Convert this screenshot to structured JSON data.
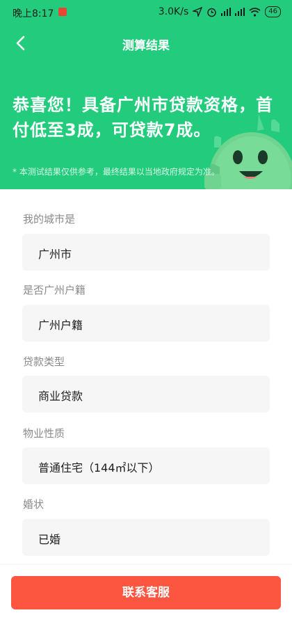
{
  "status_bar": {
    "time": "晚上8:17",
    "network_speed": "3.0K/s",
    "battery": "46",
    "icons": [
      "app-notification-icon",
      "location-icon",
      "alarm-icon",
      "hd-signal-icon",
      "hd-signal-icon",
      "wifi-icon",
      "battery-icon"
    ]
  },
  "header": {
    "title": "测算结果",
    "back_icon": "chevron-left-icon"
  },
  "result": {
    "headline": "恭喜您！具备广州市贷款资格，首付低至3成，可贷款7成。",
    "disclaimer": "* 本测试结果仅供参考，最终结果以当地政府规定为准。"
  },
  "fields": [
    {
      "label": "我的城市是",
      "value": "广州市"
    },
    {
      "label": "是否广州户籍",
      "value": "广州户籍"
    },
    {
      "label": "贷款类型",
      "value": "商业贷款"
    },
    {
      "label": "物业性质",
      "value": "普通住宅（144㎡以下）"
    },
    {
      "label": "婚状",
      "value": "已婚"
    }
  ],
  "footer": {
    "contact_label": "联系客服"
  },
  "colors": {
    "brand_green": "#22cc7c",
    "button_red": "#fd5640",
    "field_bg": "#f6f6f7",
    "label_gray": "#8a8a8a"
  }
}
